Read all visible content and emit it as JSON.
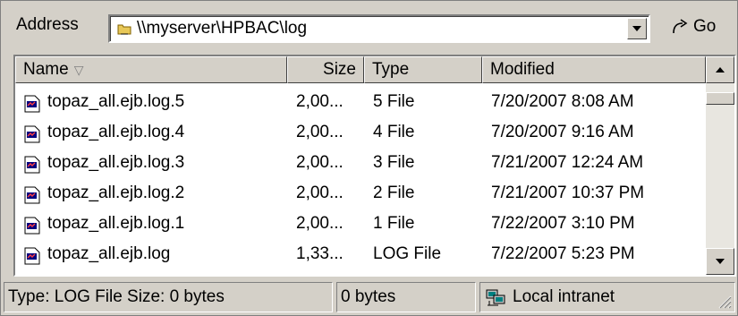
{
  "address": {
    "label": "Address",
    "value": "\\\\myserver\\HPBAC\\log",
    "go_label": "Go"
  },
  "columns": {
    "name": "Name",
    "size": "Size",
    "type": "Type",
    "modified": "Modified"
  },
  "files": [
    {
      "name": "topaz_all.ejb.log.5",
      "size": "2,00...",
      "type": "5 File",
      "modified": "7/20/2007 8:08 AM"
    },
    {
      "name": "topaz_all.ejb.log.4",
      "size": "2,00...",
      "type": "4 File",
      "modified": "7/20/2007 9:16 AM"
    },
    {
      "name": "topaz_all.ejb.log.3",
      "size": "2,00...",
      "type": "3 File",
      "modified": "7/21/2007 12:24 AM"
    },
    {
      "name": "topaz_all.ejb.log.2",
      "size": "2,00...",
      "type": "2 File",
      "modified": "7/21/2007 10:37 PM"
    },
    {
      "name": "topaz_all.ejb.log.1",
      "size": "2,00...",
      "type": "1 File",
      "modified": "7/22/2007 3:10 PM"
    },
    {
      "name": "topaz_all.ejb.log",
      "size": "1,33...",
      "type": "LOG File",
      "modified": "7/22/2007 5:23 PM"
    }
  ],
  "status": {
    "info": "Type: LOG File Size: 0 bytes",
    "size": "0 bytes",
    "zone": "Local intranet"
  },
  "icons": {
    "file": "file-icon",
    "network_folder": "network-folder-icon",
    "go": "go-arrow-icon",
    "intranet": "intranet-icon"
  }
}
